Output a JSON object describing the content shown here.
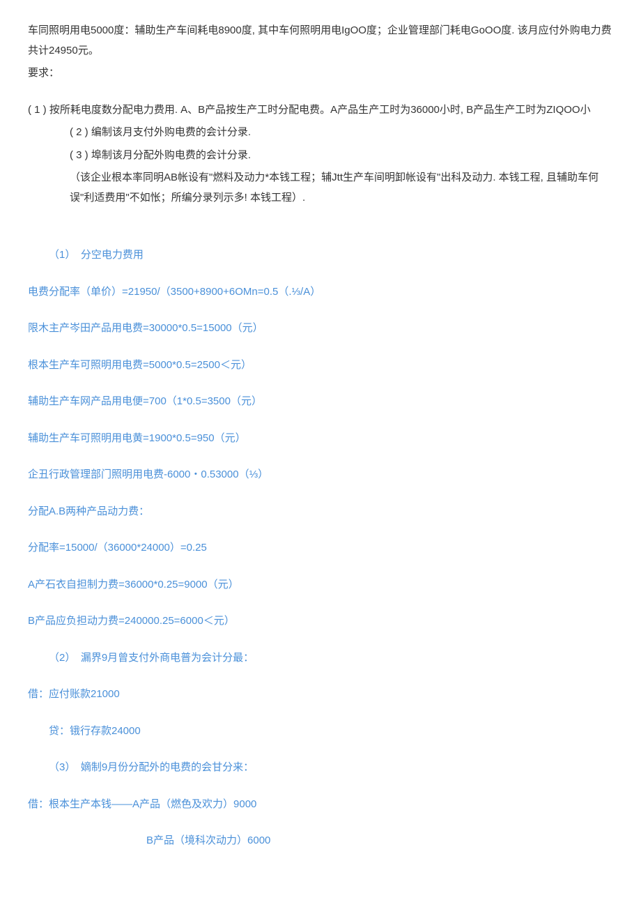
{
  "problem": {
    "para1": "车同照明用电5000度：辅助生产车间耗电8900度, 其中车何照明用电IgOO度；企业管理部门耗电GoOO度. 该月应付外购电力费共计24950元。",
    "para2": "要求：",
    "item1": "( 1 ) 按所耗电度数分配电力费用. A、B产品按生产工时分配电费。A产品生产工时为36000小时, B产品生产工时为ZIQOO小",
    "item2": "( 2 ) 编制该月支付外购电费的会计分录.",
    "item3": "( 3 ) 埠制该月分配外购电费的会计分录.",
    "note": "（该企业根本率同明AB帐设有\"燃料及动力*本钱工程；辅Jtt生产车间明卸帐设有\"出科及动力. 本钱工程, 且辅助车何误\"利适费用\"不如怅；所编分录列示多! 本钱工程）."
  },
  "solution": {
    "heading1": "（1）　分空电力费用",
    "line1": "电费分配率（单价）=21950/（3500+8900+6OMn=0.5（.⅓/A）",
    "line2": "限木主产岑田产品用电费=30000*0.5=15000（元）",
    "line3": "根本生产车可照明用电费=5000*0.5=2500＜元）",
    "line4": "辅助生产车网产品用电便=700（1*0.5=3500（元）",
    "line5": "辅助生产车可照明用电黄=1900*0.5=950（元）",
    "line6": "企丑行政管理部门照明用电费-6000・0.53000（⅓）",
    "line7": "分配A.B两种产品动力费：",
    "line8": "分配率=15000/（36000*24000）=0.25",
    "line9": "A产石衣自担制力费=36000*0.25=9000（元）",
    "line10": "B产品应负担动力费=240000.25=6000＜元）",
    "heading2": "（2）　漏界9月曾支付外商电普为会计分最：",
    "line11": "借：应付账款21000",
    "line12": "贷：锇行存款24000",
    "heading3": "（3）　嫡制9月份分配外的电费的会甘分来：",
    "line13": "借：根本生产本钱——A产品（燃色及欢力）9000",
    "line14": "B产品（境科次动力）6000"
  }
}
